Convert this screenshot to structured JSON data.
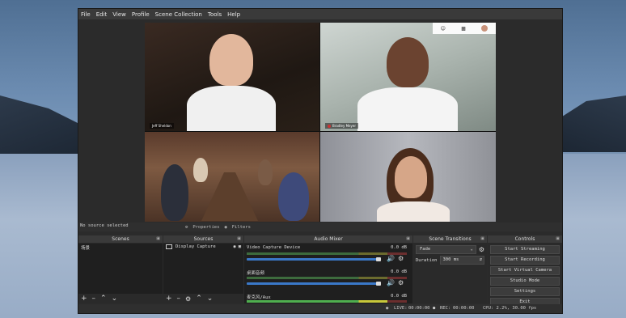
{
  "menu": [
    "File",
    "Edit",
    "View",
    "Profile",
    "Scene Collection",
    "Tools",
    "Help"
  ],
  "preview": {
    "tiles": [
      {
        "name": "Jeff Sheldon"
      },
      {
        "name": "Bradley Meyer"
      }
    ],
    "meeting_icons": [
      "people-icon",
      "chat-icon",
      "avatar"
    ]
  },
  "context_bar": {
    "no_source": "No source selected",
    "properties": "Properties",
    "filters": "Filters"
  },
  "docks": {
    "scenes": {
      "title": "Scenes",
      "items": [
        "场景"
      ]
    },
    "sources": {
      "title": "Sources",
      "items": [
        "Display Capture"
      ]
    },
    "mixer": {
      "title": "Audio Mixer",
      "channels": [
        {
          "label": "Video Capture Device",
          "db": "0.0 dB"
        },
        {
          "label": "桌面音频",
          "db": "0.0 dB"
        },
        {
          "label": "麦克风/Aux",
          "db": "0.0 dB"
        }
      ]
    },
    "transitions": {
      "title": "Scene Transitions",
      "selected": "Fade",
      "duration_label": "Duration",
      "duration_value": "300 ms"
    },
    "controls": {
      "title": "Controls",
      "buttons": [
        "Start Streaming",
        "Start Recording",
        "Start Virtual Camera",
        "Studio Mode",
        "Settings",
        "Exit"
      ]
    }
  },
  "status": {
    "live_label": "LIVE:",
    "live_time": "00:00:00",
    "rec_label": "REC:",
    "rec_time": "00:00:00",
    "cpu": "CPU: 2.2%, 30.00 fps"
  }
}
